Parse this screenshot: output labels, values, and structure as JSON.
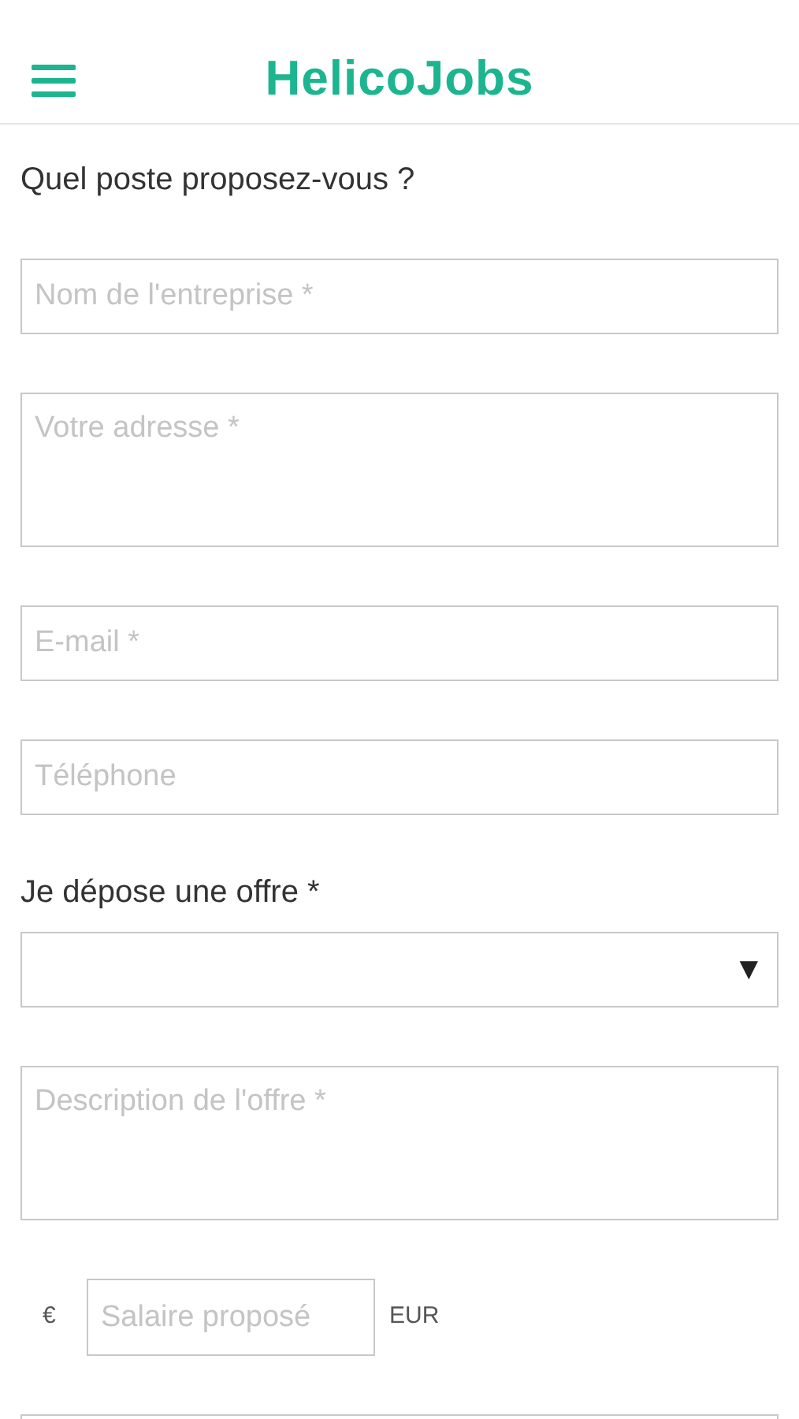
{
  "header": {
    "title": "HelicoJobs"
  },
  "heading": "Quel poste proposez-vous ?",
  "fields": [
    {
      "kind": "input",
      "placeholder": "Nom de l'entreprise *"
    },
    {
      "kind": "textarea",
      "placeholder": "Votre adresse *"
    },
    {
      "kind": "input",
      "placeholder": "E-mail *"
    },
    {
      "kind": "input",
      "placeholder": "Téléphone"
    },
    {
      "kind": "label",
      "text": "Je dépose une offre *"
    },
    {
      "kind": "select",
      "arrow": "▼"
    },
    {
      "kind": "textarea",
      "placeholder": "Description de l'offre *"
    },
    {
      "kind": "salary",
      "prefix": "€",
      "placeholder": "Salaire proposé",
      "suffix": "EUR"
    },
    {
      "kind": "input"
    }
  ]
}
